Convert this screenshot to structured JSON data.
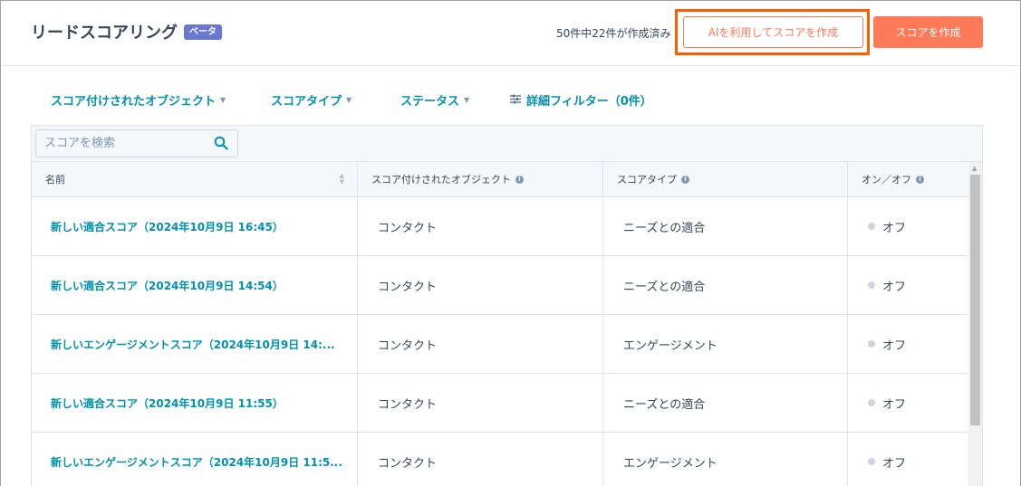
{
  "header": {
    "title": "リードスコアリング",
    "badge": "ベータ",
    "created_count": "50件中22件が作成済み",
    "ai_button_label": "AIを利用してスコアを作成",
    "create_button_label": "スコアを作成"
  },
  "filters": {
    "scored_object": "スコア付けされたオブジェクト",
    "score_type": "スコアタイプ",
    "status": "ステータス",
    "advanced": "詳細フィルター（0件）"
  },
  "search": {
    "placeholder": "スコアを検索"
  },
  "table": {
    "columns": {
      "name": "名前",
      "object": "スコア付けされたオブジェクト",
      "type": "スコアタイプ",
      "status": "オン／オフ"
    },
    "rows": [
      {
        "name": "新しい適合スコア（2024年10月9日 16:45）",
        "object": "コンタクト",
        "type": "ニーズとの適合",
        "status": "オフ"
      },
      {
        "name": "新しい適合スコア（2024年10月9日 14:54）",
        "object": "コンタクト",
        "type": "ニーズとの適合",
        "status": "オフ"
      },
      {
        "name": "新しいエンゲージメントスコア（2024年10月9日 14:...",
        "object": "コンタクト",
        "type": "エンゲージメント",
        "status": "オフ"
      },
      {
        "name": "新しい適合スコア（2024年10月9日 11:55）",
        "object": "コンタクト",
        "type": "ニーズとの適合",
        "status": "オフ"
      },
      {
        "name": "新しいエンゲージメントスコア（2024年10月9日 11:5...",
        "object": "コンタクト",
        "type": "エンゲージメント",
        "status": "オフ"
      }
    ]
  },
  "colors": {
    "accent": "#ff7a59",
    "highlight": "#ff5c00",
    "link": "#0091ae",
    "badge": "#6a78d1"
  },
  "icons": {
    "search": "search-icon",
    "filter": "sliders-icon",
    "info": "info-icon",
    "sort": "sort-icon",
    "status": "status-dot-icon"
  }
}
